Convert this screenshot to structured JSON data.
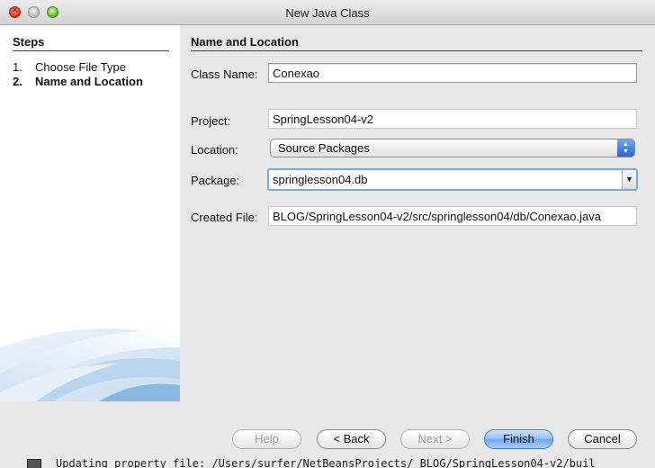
{
  "window": {
    "title": "New Java Class"
  },
  "steps": {
    "heading": "Steps",
    "items": [
      {
        "num": "1.",
        "label": "Choose File Type"
      },
      {
        "num": "2.",
        "label": "Name and Location"
      }
    ]
  },
  "form": {
    "heading": "Name and Location",
    "class_name": {
      "label": "Class Name:",
      "value": "Conexao"
    },
    "project": {
      "label": "Project:",
      "value": "SpringLesson04-v2"
    },
    "location": {
      "label": "Location:",
      "value": "Source Packages"
    },
    "package": {
      "label": "Package:",
      "value": "springlesson04.db"
    },
    "created_file": {
      "label": "Created File:",
      "value": "BLOG/SpringLesson04-v2/src/springlesson04/db/Conexao.java"
    }
  },
  "buttons": {
    "help": "Help",
    "back": "< Back",
    "next": "Next >",
    "finish": "Finish",
    "cancel": "Cancel"
  },
  "background_status": "Updating property file: /Users/surfer/NetBeansProjects/ BLOG/SpringLesson04-v2/buil",
  "colors": {
    "accent": "#6ea7ef",
    "close": "#d8281b",
    "zoom": "#5fb52a"
  }
}
